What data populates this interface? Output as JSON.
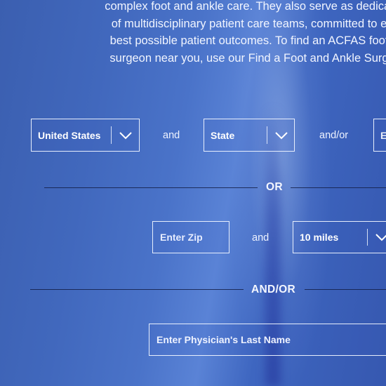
{
  "intro": {
    "lines": [
      "complex foot and ankle care. They also serve as dedicat",
      "of multidisciplinary patient care teams, committed to e",
      "best possible patient outcomes. To find an ACFAS foot",
      "surgeon near you, use our Find a Foot and Ankle Surg"
    ]
  },
  "search": {
    "country": {
      "value": "United States"
    },
    "and_1": "and",
    "state": {
      "value": "State"
    },
    "and_or_1": "and/or",
    "city": {
      "value": "E"
    },
    "or_label": "OR",
    "zip": {
      "placeholder": "Enter Zip"
    },
    "and_2": "and",
    "distance": {
      "value": "10 miles"
    },
    "and_or_label": "AND/OR",
    "last_name": {
      "placeholder": "Enter Physician's Last Name"
    }
  },
  "icons": {
    "dropdown": "chevron-down-icon"
  }
}
